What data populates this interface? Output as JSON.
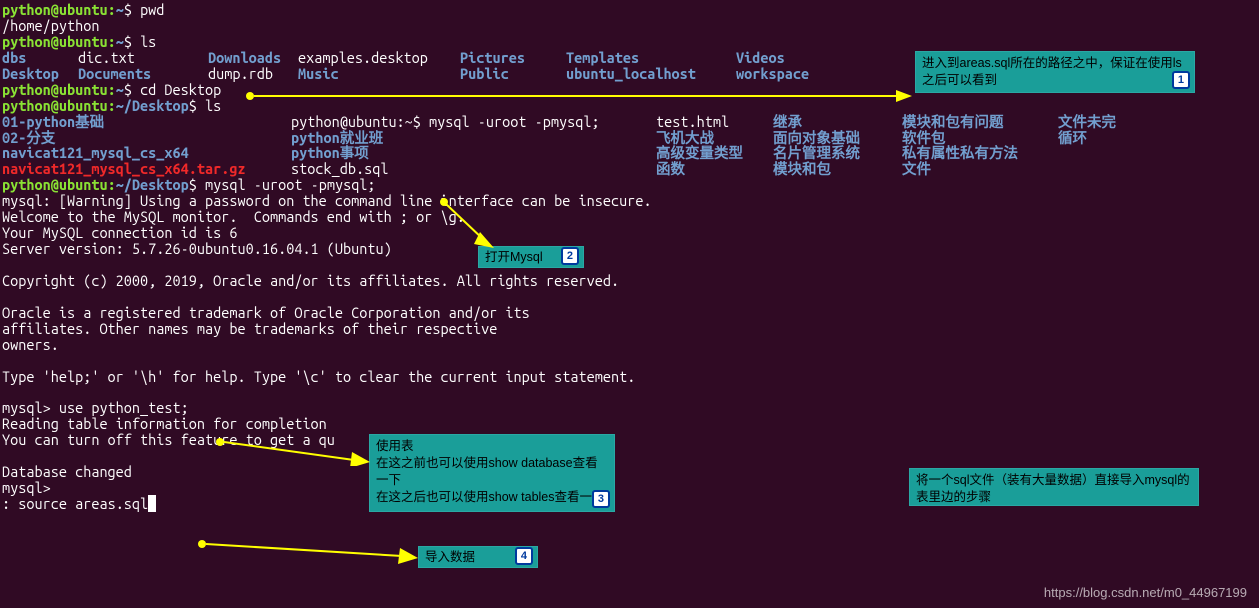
{
  "prompt": {
    "user": "python@ubuntu",
    "home": "~",
    "desktop": "~/Desktop",
    "sep": ":",
    "dollar": "$"
  },
  "cmds": {
    "pwd": "pwd",
    "pwd_out": "/home/python",
    "ls": "ls",
    "cd": "cd Desktop",
    "ls2": "ls",
    "mysql_login": "mysql -uroot -pmysql;",
    "use_db": "use python_test;",
    "source": "source areas.sql"
  },
  "ls_home": {
    "r1": {
      "c1": "dbs",
      "c2": "dic.txt",
      "c3": "Downloads",
      "c4": "examples.desktop",
      "c5": "Pictures",
      "c6": "Templates",
      "c7": "Videos"
    },
    "r2": {
      "c1": "Desktop",
      "c2": "Documents",
      "c3": "dump.rdb",
      "c4": "Music",
      "c5": "Public",
      "c6": "ubuntu_localhost",
      "c7": "workspace"
    }
  },
  "ls_desktop": {
    "r1": {
      "c1": "01-python基础",
      "c2": "python@ubuntu:~$ mysql -uroot -pmysql;",
      "c3": "test.html",
      "c4": "继承",
      "c5": "模块和包有问题",
      "c6": "文件未完"
    },
    "r2": {
      "c1": "02-分支",
      "c2": "python就业班",
      "c3": "飞机大战",
      "c4": "面向对象基础",
      "c5": "软件包",
      "c6": "循环"
    },
    "r3": {
      "c1": "navicat121_mysql_cs_x64",
      "c2": "python事项",
      "c3": "高级变量类型",
      "c4": "名片管理系统",
      "c5": "私有属性私有方法"
    },
    "r4": {
      "c1": "navicat121_mysql_cs_x64.tar.gz",
      "c2": "stock_db.sql",
      "c3": "函数",
      "c4": "模块和包",
      "c5": "文件"
    }
  },
  "mysql_out": {
    "l1": "mysql: [Warning] Using a password on the command line interface can be insecure.",
    "l2": "Welcome to the MySQL monitor.  Commands end with ; or \\g.",
    "l3": "Your MySQL connection id is 6",
    "l4": "Server version: 5.7.26-0ubuntu0.16.04.1 (Ubuntu)",
    "l5": "Copyright (c) 2000, 2019, Oracle and/or its affiliates. All rights reserved.",
    "l6": "Oracle is a registered trademark of Oracle Corporation and/or its",
    "l7": "affiliates. Other names may be trademarks of their respective",
    "l8": "owners.",
    "l9": "Type 'help;' or '\\h' for help. Type '\\c' to clear the current input statement.",
    "l10": "mysql> ",
    "l11": "Reading table information for completion ",
    "l12": "You can turn off this feature to get a qu",
    "l13": "Database changed",
    "l14": "mysql>",
    "l15": ": "
  },
  "annot": {
    "a1": {
      "text": "进入到areas.sql所在的路径之中，保证在使用ls之后可以看到",
      "num": "1"
    },
    "a2": {
      "text": "打开Mysql",
      "num": "2"
    },
    "a3": {
      "t1": "使用表",
      "t2": "在这之前也可以使用show database查看一下",
      "t3": "在这之后也可以使用show tables查看一下",
      "num": "3"
    },
    "a4": {
      "text": "导入数据",
      "num": "4"
    },
    "a5": {
      "text": "将一个sql文件（装有大量数据）直接导入mysql的表里边的步骤"
    }
  },
  "watermark": "https://blog.csdn.net/m0_44967199"
}
